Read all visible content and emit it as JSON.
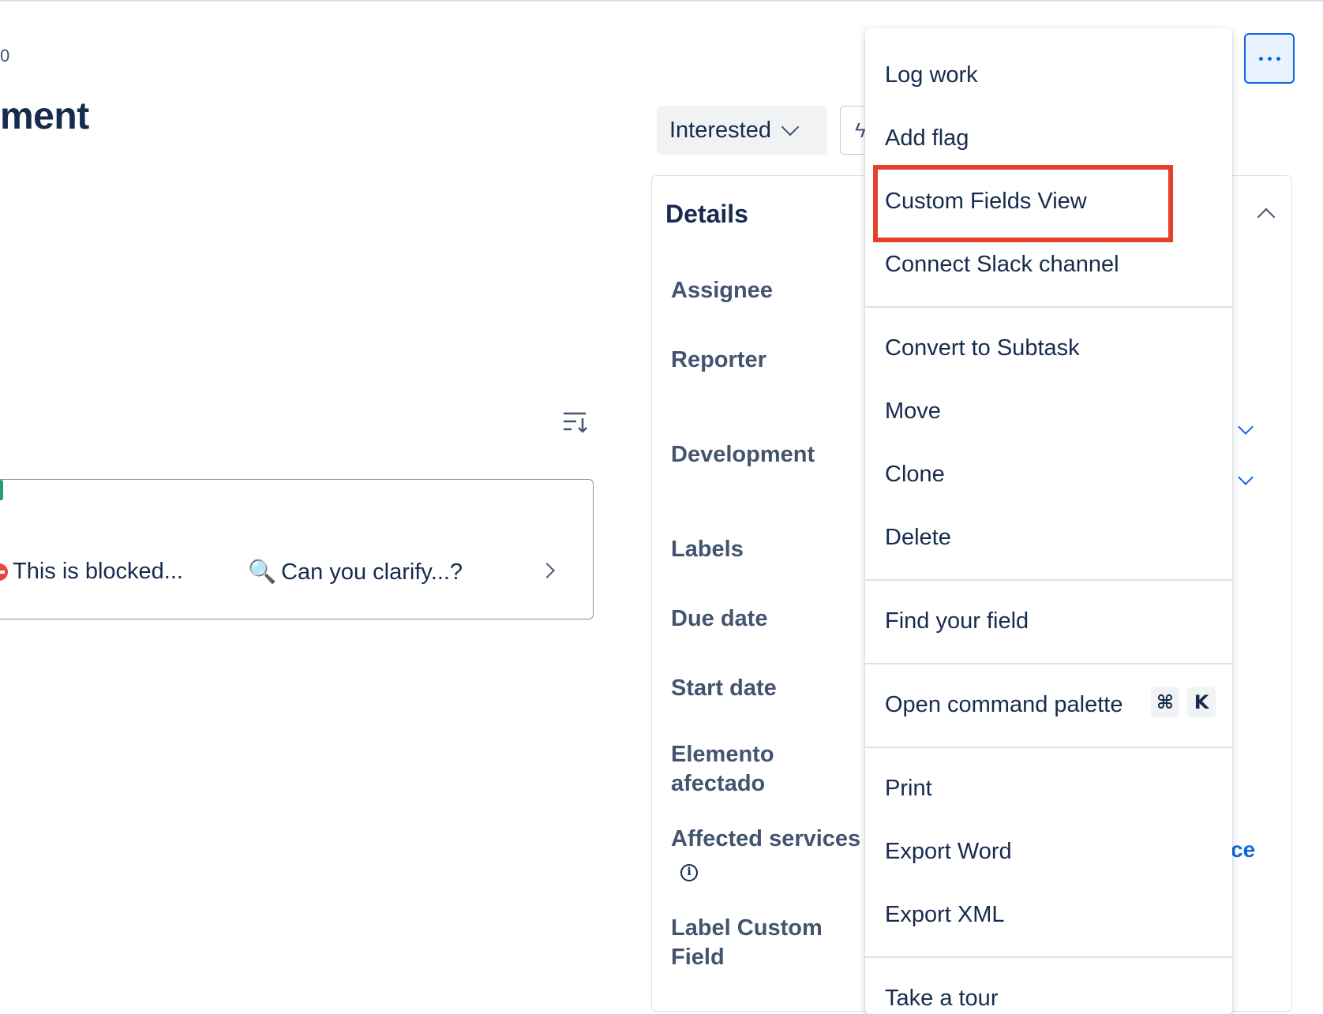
{
  "header": {
    "breadcrumb_fragment": "0",
    "title_fragment": "ment"
  },
  "toolbar": {
    "watch_label": "Interested",
    "automation_glyph": "ϟ",
    "more_button_icon": "more-horizontal-icon"
  },
  "activity": {
    "reactions": [
      {
        "icon": "no-entry-icon",
        "label": "This is blocked..."
      },
      {
        "icon": "magnifier-icon",
        "label": "Can you clarify...?"
      },
      {
        "icon": "green-marker",
        "label": ""
      }
    ]
  },
  "details": {
    "title": "Details",
    "fields": [
      {
        "label": "Assignee"
      },
      {
        "label": "Reporter"
      },
      {
        "label": "Development"
      },
      {
        "label": "Labels"
      },
      {
        "label": "Due date"
      },
      {
        "label": "Start date"
      },
      {
        "label": "Elemento afectado",
        "line1": "Elemento",
        "line2": "afectado"
      },
      {
        "label": "Affected services",
        "info_glyph": "i"
      },
      {
        "label": "Label Custom Field",
        "line1": "Label Custom",
        "line2": "Field"
      }
    ],
    "partial_link_text": "ce"
  },
  "menu": {
    "groups": [
      [
        "Log work",
        "Add flag",
        "Custom Fields View",
        "Connect Slack channel"
      ],
      [
        "Convert to Subtask",
        "Move",
        "Clone",
        "Delete"
      ],
      [
        "Find your field"
      ],
      [
        "Open command palette"
      ],
      [
        "Print",
        "Export Word",
        "Export XML"
      ],
      [
        "Take a tour"
      ]
    ],
    "shortcut_keys": [
      "⌘",
      "K"
    ],
    "highlighted_item": "Custom Fields View"
  },
  "colors": {
    "accent": "#0c66e4",
    "highlight": "#e5402b",
    "text": "#172b4d",
    "subtle_text": "#44546f"
  }
}
